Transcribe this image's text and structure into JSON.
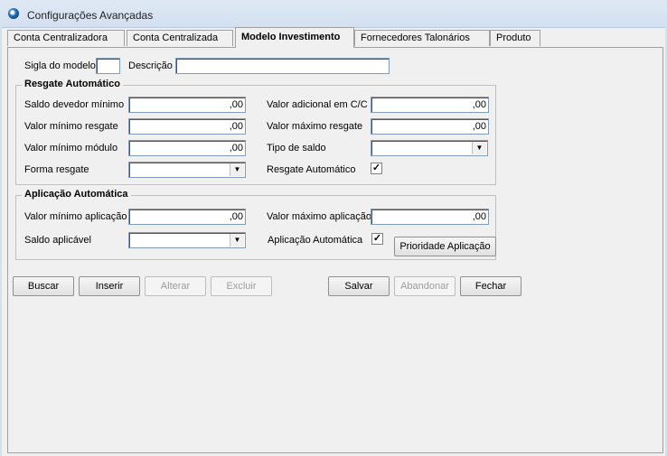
{
  "window": {
    "title": "Configurações Avançadas"
  },
  "tabs": [
    {
      "label": "Conta Centralizadora"
    },
    {
      "label": "Conta Centralizada"
    },
    {
      "label": "Modelo Investimento"
    },
    {
      "label": "Fornecedores Talonários"
    },
    {
      "label": "Produto"
    }
  ],
  "model": {
    "sigla_label": "Sigla do modelo",
    "sigla_value": "",
    "descricao_label": "Descrição",
    "descricao_value": ""
  },
  "resgate": {
    "title": "Resgate Automático",
    "saldo_devedor_label": "Saldo devedor mínimo",
    "saldo_devedor_value": ",00",
    "valor_adicional_label": "Valor adicional em C/C",
    "valor_adicional_value": ",00",
    "valor_min_resgate_label": "Valor mínimo resgate",
    "valor_min_resgate_value": ",00",
    "valor_max_resgate_label": "Valor máximo resgate",
    "valor_max_resgate_value": ",00",
    "valor_min_modulo_label": "Valor mínimo módulo",
    "valor_min_modulo_value": ",00",
    "tipo_saldo_label": "Tipo de saldo",
    "tipo_saldo_value": "",
    "forma_resgate_label": "Forma resgate",
    "forma_resgate_value": "",
    "auto_label": "Resgate Automático",
    "auto_checked": "✓"
  },
  "aplicacao": {
    "title": "Aplicação Automática",
    "valor_min_label": "Valor mínimo aplicação",
    "valor_min_value": ",00",
    "valor_max_label": "Valor máximo aplicação",
    "valor_max_value": ",00",
    "saldo_aplicavel_label": "Saldo aplicável",
    "saldo_aplicavel_value": "",
    "auto_label": "Aplicação Automática",
    "auto_checked": "✓",
    "prioridade_button": "Prioridade Aplicação"
  },
  "buttons": {
    "buscar": "Buscar",
    "inserir": "Inserir",
    "alterar": "Alterar",
    "excluir": "Excluir",
    "salvar": "Salvar",
    "abandonar": "Abandonar",
    "fechar": "Fechar"
  }
}
